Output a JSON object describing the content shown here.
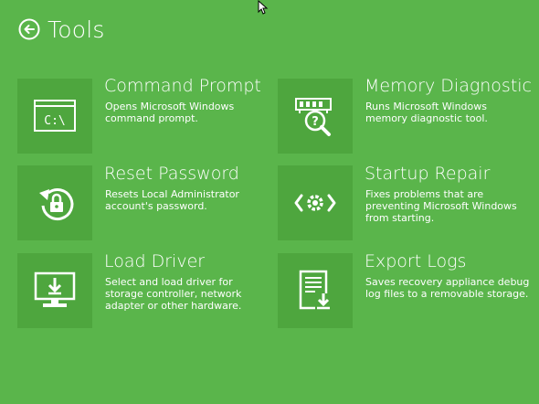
{
  "page": {
    "title": "Tools",
    "back_icon": "back-arrow-circle-icon"
  },
  "tools": [
    {
      "title": "Command Prompt",
      "description": "Opens Microsoft Windows command prompt.",
      "icon": "command-prompt-icon",
      "icon_text": "C:\\"
    },
    {
      "title": "Memory Diagnostic",
      "description": "Runs Microsoft Windows memory diagnostic tool.",
      "icon": "memory-diagnostic-icon"
    },
    {
      "title": "Reset Password",
      "description": "Resets Local Administrator account's password.",
      "icon": "reset-password-icon"
    },
    {
      "title": "Startup Repair",
      "description": "Fixes problems that are preventing Microsoft Windows from starting.",
      "icon": "startup-repair-icon"
    },
    {
      "title": "Load Driver",
      "description": "Select and load driver for storage controller, network adapter or other hardware.",
      "icon": "load-driver-icon"
    },
    {
      "title": "Export Logs",
      "description": "Saves recovery appliance debug log files to a removable storage.",
      "icon": "export-logs-icon"
    }
  ],
  "colors": {
    "background": "#5ab54b",
    "tile": "#4ea63e",
    "text": "#ffffff"
  }
}
